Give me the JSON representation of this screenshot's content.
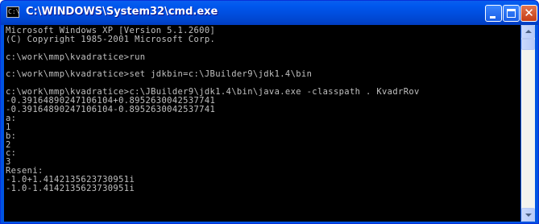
{
  "window": {
    "title": "C:\\WINDOWS\\System32\\cmd.exe",
    "icon": "cmd-icon",
    "icon_text": "C:\\",
    "controls": {
      "minimize": "minimize-icon",
      "maximize": "maximize-icon",
      "close": "close-icon",
      "close_glyph": "✕"
    }
  },
  "colors": {
    "console_bg": "#000000",
    "console_fg": "#c0c0c0",
    "titlebar": "#0054e3"
  },
  "console": {
    "lines": [
      "Microsoft Windows XP [Version 5.1.2600]",
      "(C) Copyright 1985-2001 Microsoft Corp.",
      "",
      "c:\\work\\mmp\\kvadratice>run",
      "",
      "c:\\work\\mmp\\kvadratice>set jdkbin=c:\\JBuilder9\\jdk1.4\\bin",
      "",
      "c:\\work\\mmp\\kvadratice>c:\\JBuilder9\\jdk1.4\\bin\\java.exe -classpath . KvadrRov",
      "-0.39164890247106104+0.8952630042537741",
      "-0.39164890247106104-0.8952630042537741",
      "a:",
      "1",
      "b:",
      "2",
      "c:",
      "3",
      "Reseni:",
      "-1.0+1.4142135623730951i",
      "-1.0-1.4142135623730951i",
      ""
    ]
  }
}
